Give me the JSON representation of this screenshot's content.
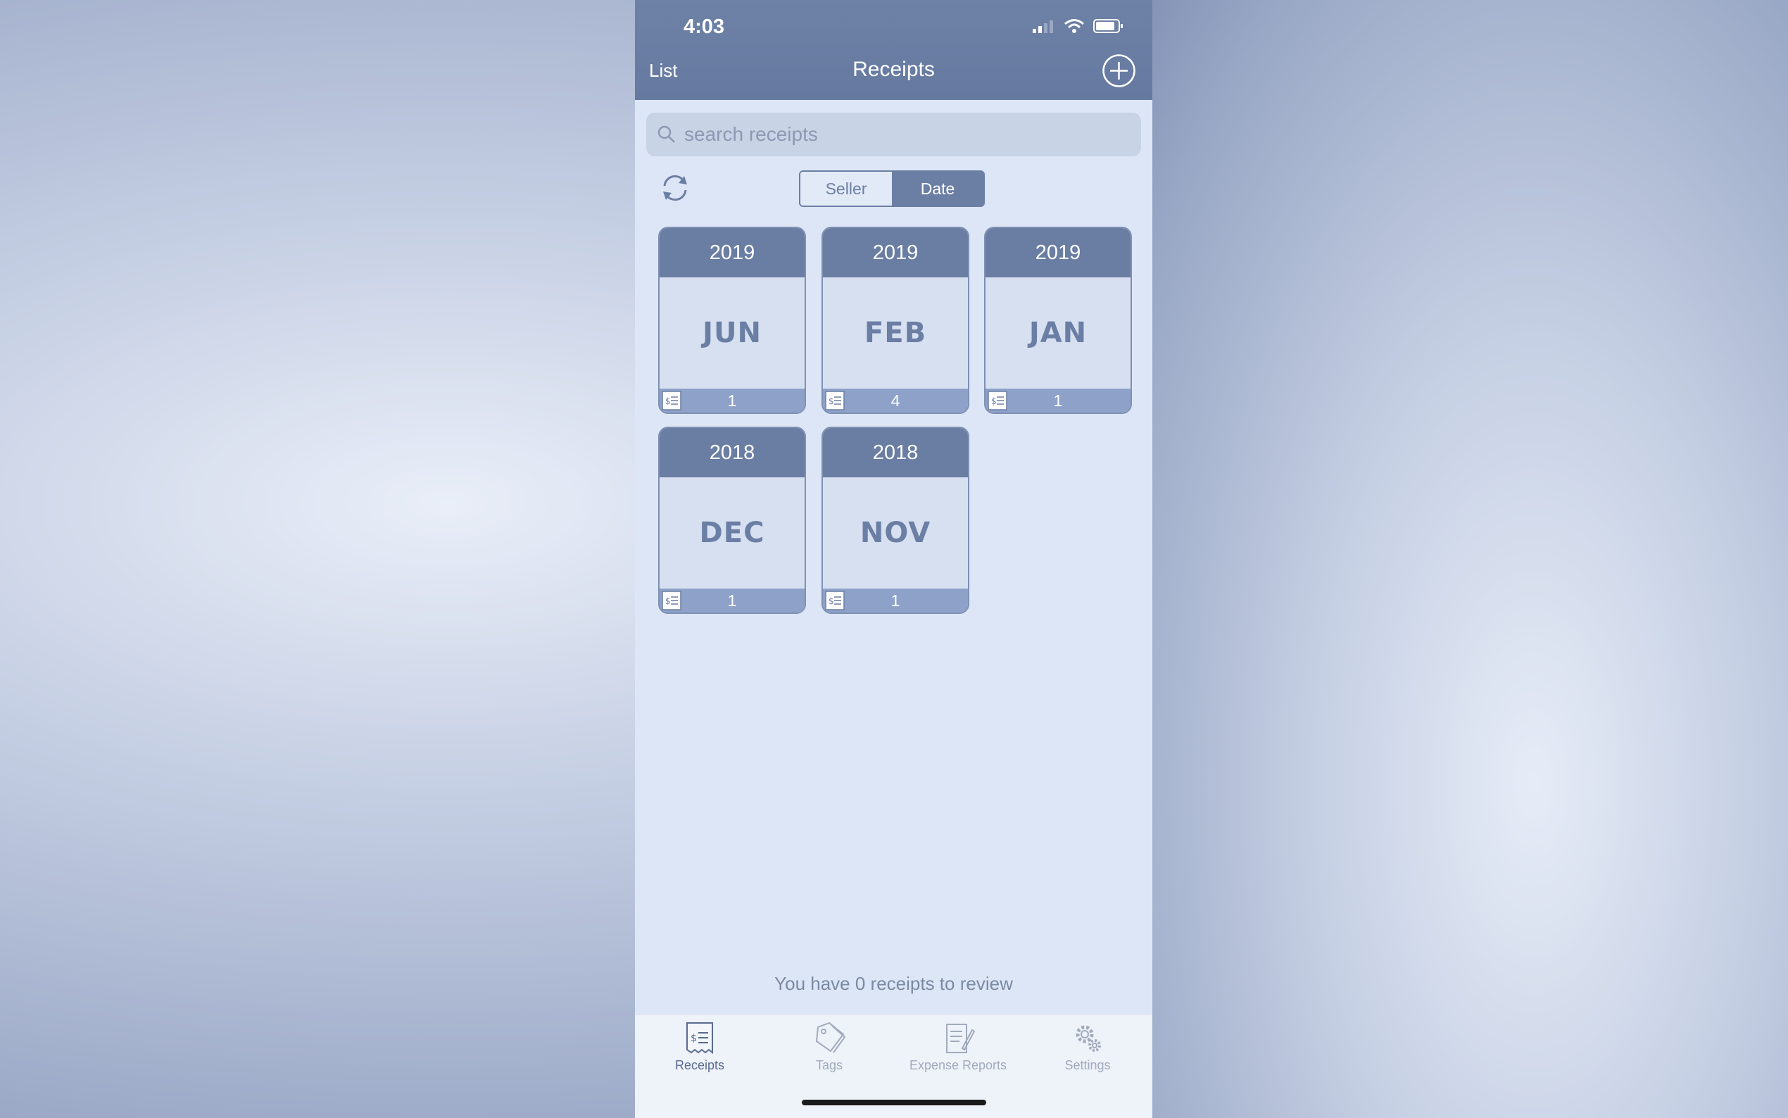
{
  "status_bar": {
    "time": "4:03"
  },
  "nav": {
    "left_label": "List",
    "title": "Receipts"
  },
  "search": {
    "placeholder": "search receipts"
  },
  "segmented": {
    "options": [
      "Seller",
      "Date"
    ],
    "selected": "Date"
  },
  "cards": [
    {
      "year": "2019",
      "month": "JUN",
      "count": "1"
    },
    {
      "year": "2019",
      "month": "FEB",
      "count": "4"
    },
    {
      "year": "2019",
      "month": "JAN",
      "count": "1"
    },
    {
      "year": "2018",
      "month": "DEC",
      "count": "1"
    },
    {
      "year": "2018",
      "month": "NOV",
      "count": "1"
    }
  ],
  "review_text": "You have 0 receipts to review",
  "tabs": [
    {
      "label": "Receipts",
      "icon": "receipt-icon",
      "active": true
    },
    {
      "label": "Tags",
      "icon": "tag-icon",
      "active": false
    },
    {
      "label": "Expense Reports",
      "icon": "report-icon",
      "active": false
    },
    {
      "label": "Settings",
      "icon": "gear-icon",
      "active": false
    }
  ],
  "colors": {
    "nav_bar": "#6a7da3",
    "accent": "#6b7ea4",
    "background": "#dde6f6"
  }
}
